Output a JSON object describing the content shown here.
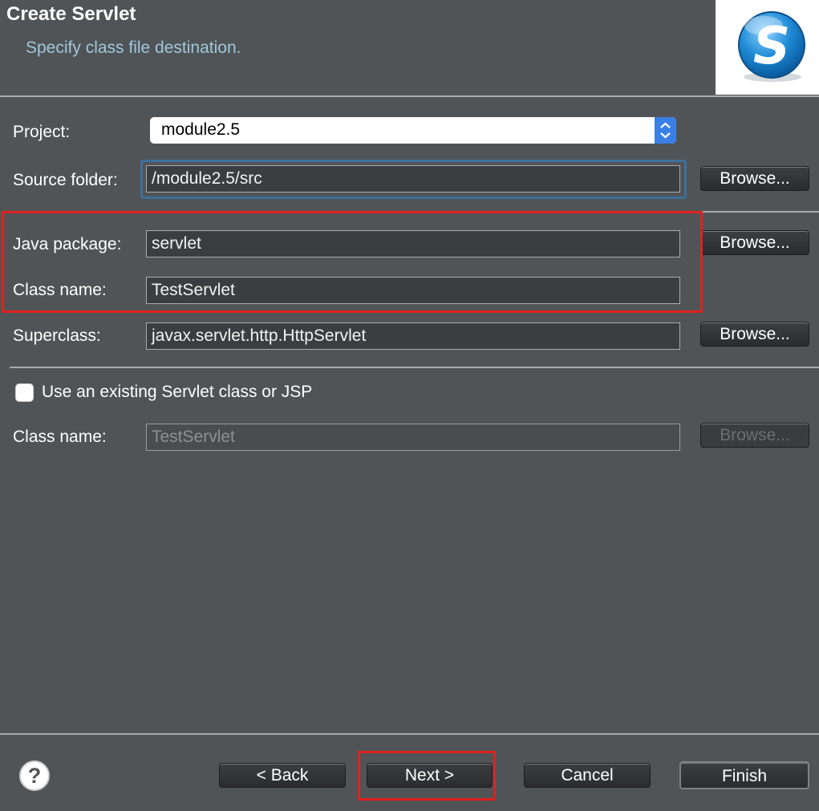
{
  "header": {
    "title": "Create Servlet",
    "subtitle": "Specify class file destination.",
    "logo_letter": "S",
    "logo_icon": "servlet-wizard-logo-icon"
  },
  "form": {
    "project_label": "Project:",
    "project_value": "module2.5",
    "source_folder_label": "Source folder:",
    "source_folder_value": "/module2.5/src",
    "java_package_label": "Java package:",
    "java_package_value": "servlet",
    "class_name_label": "Class name:",
    "class_name_value": "TestServlet",
    "superclass_label": "Superclass:",
    "superclass_value": "javax.servlet.http.HttpServlet",
    "browse_label": "Browse..."
  },
  "existing": {
    "checkbox_label": "Use an existing Servlet class or JSP",
    "checked": false,
    "class_name_label": "Class name:",
    "class_name_value": "TestServlet",
    "browse_label": "Browse..."
  },
  "footer": {
    "help_glyph": "?",
    "back_label": "< Back",
    "next_label": "Next >",
    "cancel_label": "Cancel",
    "finish_label": "Finish"
  },
  "colors": {
    "background": "#505456",
    "accent_text": "#9fc7dd",
    "highlight": "#e0211f",
    "focus": "#3e6f9c"
  }
}
